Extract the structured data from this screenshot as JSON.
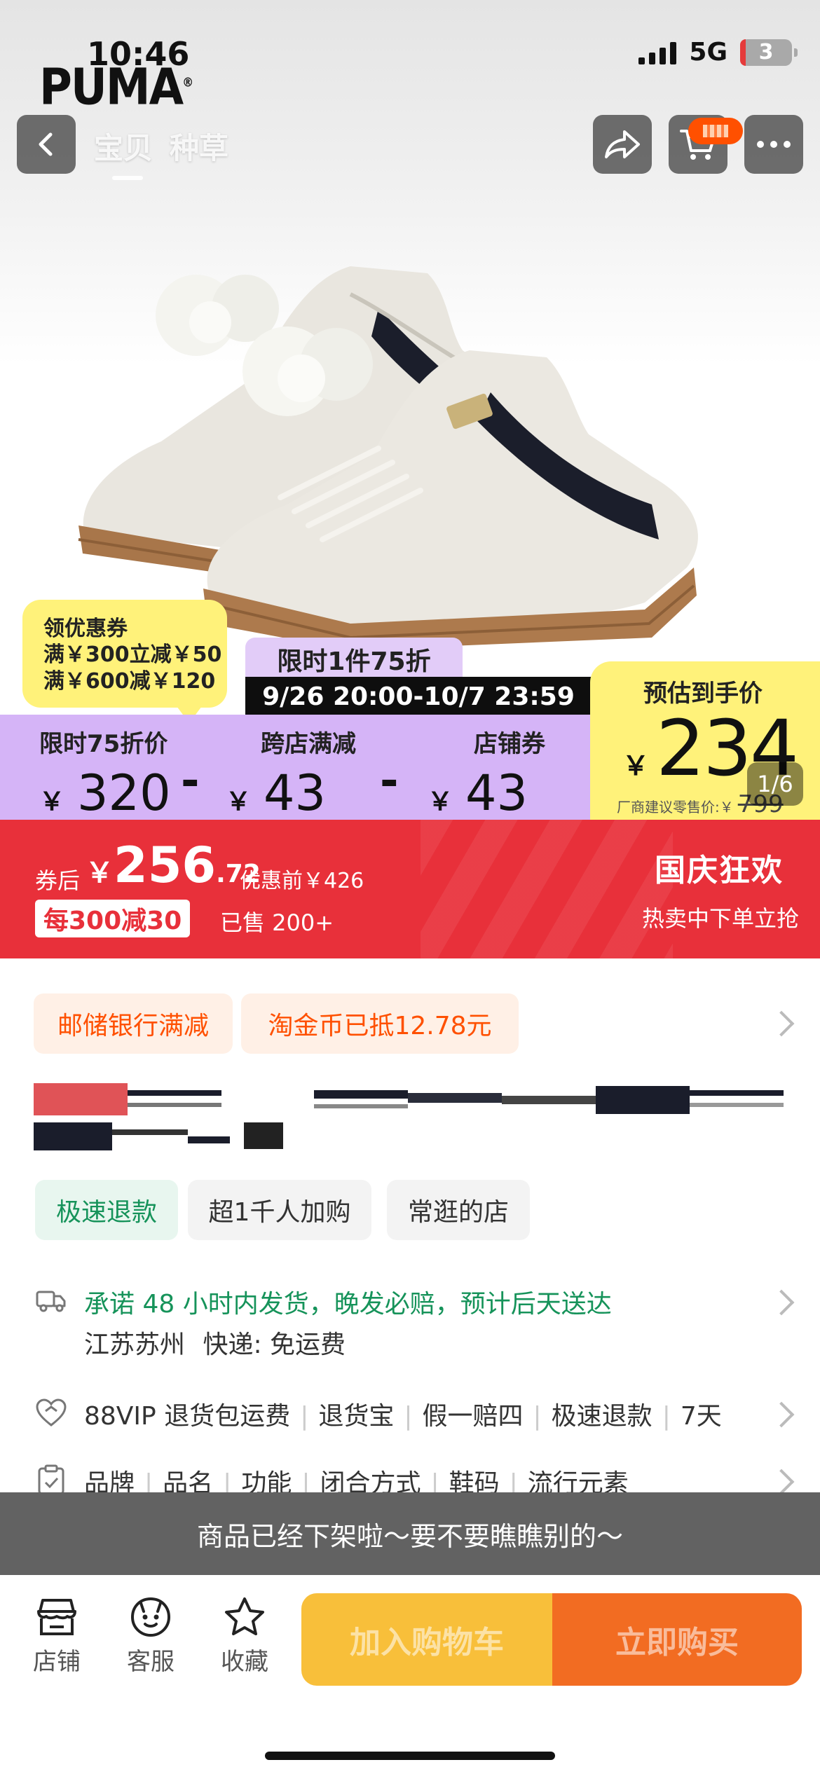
{
  "status_bar": {
    "time": "10:46",
    "network": "5G",
    "battery": "3"
  },
  "brand": {
    "logo_text": "PUMA",
    "logo_mark": "®"
  },
  "nav": {
    "tabs": [
      "宝贝",
      "种草"
    ],
    "icons": [
      "back-icon",
      "share-icon",
      "cart-icon",
      "more-icon"
    ]
  },
  "gallery": {
    "counter": "1/6"
  },
  "coupon": {
    "title": "领优惠券",
    "lines": [
      "满￥300立减￥50",
      "满￥600减￥120"
    ]
  },
  "flash_sale": {
    "tag": "限时1件75折",
    "time_range": "9/26 20:00-10/7 23:59"
  },
  "price_breakdown": [
    {
      "label": "限时75折价",
      "currency": "￥",
      "amount": "320"
    },
    {
      "label": "跨店满减",
      "currency": "￥",
      "amount": "43"
    },
    {
      "label": "店铺券",
      "currency": "￥",
      "amount": "43"
    }
  ],
  "operators": [
    "-",
    "-"
  ],
  "estimate": {
    "label": "预估到手价",
    "currency": "￥",
    "price": "234",
    "retail_label": "厂商建议零售价:￥",
    "retail_price": "799"
  },
  "promo_banner": {
    "after_label": "券后",
    "currency": "￥",
    "price_int": "256",
    "price_dec": ".72",
    "original": "优惠前￥426",
    "per_tag": "每300减30",
    "sold": "已售 200+",
    "event_title": "国庆狂欢",
    "event_sub": "热卖中下单立抢",
    "colors": {
      "background": "#e8303a"
    }
  },
  "benefits": {
    "chips": [
      "邮储银行满减",
      "淘金币已抵12.78元"
    ]
  },
  "tags": [
    "极速退款",
    "超1千人加购",
    "常逛的店"
  ],
  "shipping": {
    "promise": "承诺 48 小时内发货，晚发必赔，预计后天送达",
    "origin": "江苏苏州",
    "express": "快递: 免运费"
  },
  "guarantees": [
    "88VIP 退货包运费",
    "退货宝",
    "假一赔四",
    "极速退款",
    "7天"
  ],
  "params": [
    "品牌",
    "品名",
    "功能",
    "闭合方式",
    "鞋码",
    "流行元素"
  ],
  "offline_notice": "商品已经下架啦～要不要瞧瞧别的～",
  "bottom_bar": {
    "tools": [
      {
        "label": "店铺",
        "icon": "store-icon"
      },
      {
        "label": "客服",
        "icon": "service-icon"
      },
      {
        "label": "收藏",
        "icon": "star-icon"
      }
    ],
    "add_to_cart": "加入购物车",
    "buy_now": "立即购买",
    "colors": {
      "cart": "#f8bf3a",
      "buy": "#f26c22"
    }
  }
}
